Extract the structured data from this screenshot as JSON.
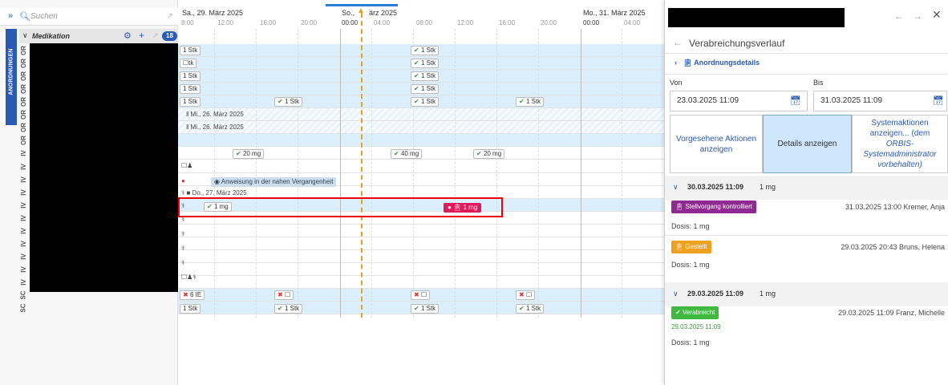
{
  "search": {
    "placeholder": "Suchen"
  },
  "sidebar": {
    "tab_label": "ANORDNUNGEN",
    "section_title": "Medikation",
    "badge": "18",
    "type_labels": [
      "OR",
      "OR",
      "OR",
      "OR",
      "OR",
      "OR",
      "OR",
      "OR",
      "IV",
      "IV",
      "IV",
      "IV",
      "IV",
      "IV",
      "IV",
      "IV",
      "IV",
      "IV",
      "IV",
      "SC",
      "SC"
    ]
  },
  "timeline": {
    "dates": [
      "Sa., 29. März 2025",
      "So.,",
      "ärz 2025",
      "Mo., 31. März 2025"
    ],
    "times": [
      "8:00",
      "12:00",
      "16:00",
      "20:00",
      "00:00",
      "04:00",
      "08:00",
      "12:00",
      "16:00",
      "20:00",
      "00:00",
      "04:00"
    ],
    "chips": {
      "stk": "1 Stk",
      "mg1": "1 mg",
      "mg20": "20 mg",
      "mg40": "40 mg",
      "ie": "6 IE"
    },
    "paused1": "Mi., 26. März 2025",
    "paused2": "Mi., 26. März 2025",
    "instruction": "Anweisung in der nahen Vergangenheit",
    "date_do": "Do., 27. März 2025",
    "highlight": "1 mg"
  },
  "panel": {
    "title": "Verabreichungsverlauf",
    "order_details": "Anordnungsdetails",
    "from_label": "Von",
    "to_label": "Bis",
    "from_value": "23.03.2025 11:09",
    "to_value": "31.03.2025 11:09",
    "btn_planned": "Vorgesehene Aktionen anzeigen",
    "btn_details": "Details anzeigen",
    "btn_system_1": "Systemaktionen anzeigen... (dem",
    "btn_system_2": "ORBIS-",
    "btn_system_3": "Systemadministrator vorbehalten)",
    "groups": [
      {
        "date": "30.03.2025 11:09",
        "dose": "1 mg"
      },
      {
        "date": "29.03.2025 11:09",
        "dose": "1 mg"
      }
    ],
    "entries": [
      {
        "status": "Stellvorgang kontrolliert",
        "meta": "31.03.2025 13:00 Kremer, Anja",
        "dosis": "Dosis: 1 mg",
        "color": "#8e2a91"
      },
      {
        "status": "Gestellt",
        "meta": "29.03.2025 20:43 Bruns, Helena",
        "dosis": "Dosis: 1 mg",
        "color": "#f0a020"
      },
      {
        "status": "Verabreicht",
        "meta": "29.03.2025 11:09 Franz, Michelle",
        "dosis": "Dosis: 1 mg",
        "extra": "29.03.2025 11:09",
        "color": "#3fb93f"
      }
    ]
  }
}
